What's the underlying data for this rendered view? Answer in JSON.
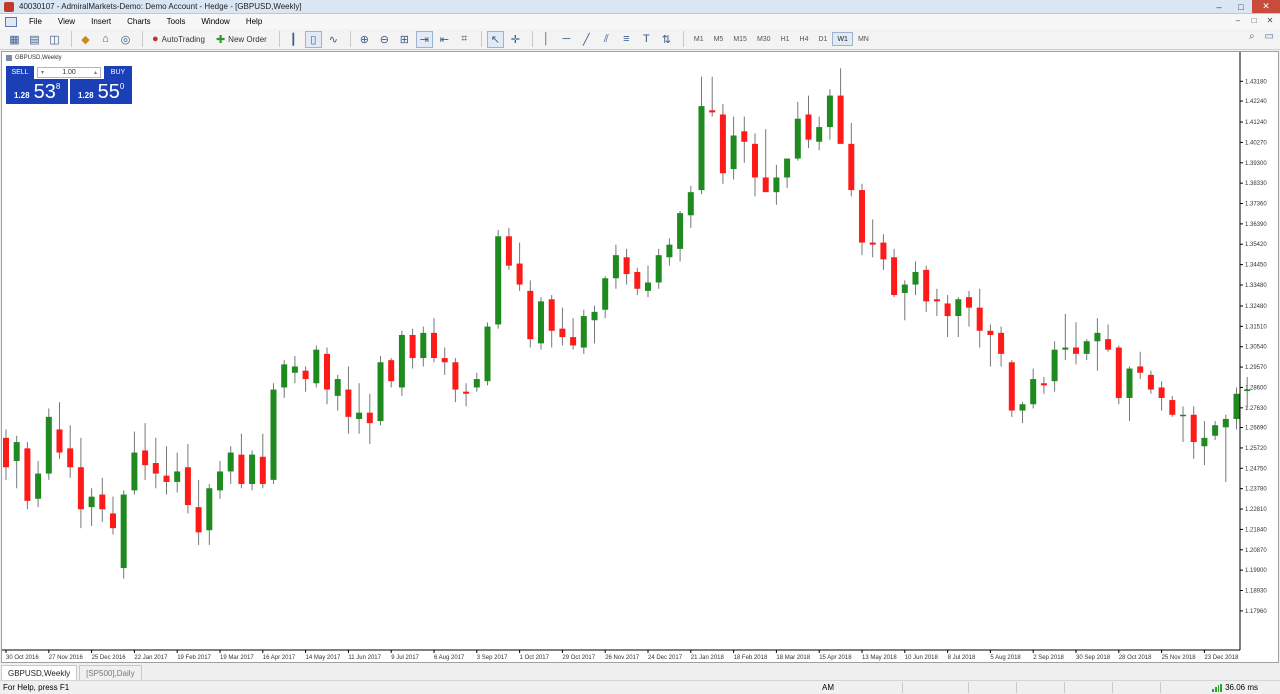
{
  "window": {
    "title": "40030107 - AdmiralMarkets-Demo: Demo Account - Hedge - [GBPUSD,Weekly]",
    "controls": [
      "–",
      "□",
      "✕"
    ]
  },
  "menu": {
    "items": [
      "File",
      "View",
      "Insert",
      "Charts",
      "Tools",
      "Window",
      "Help"
    ]
  },
  "toolbar": {
    "autotrading_label": "AutoTrading",
    "new_order_label": "New Order",
    "timeframes": [
      "M1",
      "M5",
      "M15",
      "M30",
      "H1",
      "H4",
      "D1",
      "W1",
      "MN"
    ],
    "active_timeframe": "W1"
  },
  "chart": {
    "header": "GBPUSD,Weekly",
    "trade_panel": {
      "sell_label": "SELL",
      "buy_label": "BUY",
      "lot": "1.00",
      "sell_price_prefix": "1.28",
      "sell_price_big": "53",
      "sell_price_sup": "8",
      "buy_price_prefix": "1.28",
      "buy_price_big": "55",
      "buy_price_sup": "0"
    },
    "colors": {
      "bull": "#1f8a1f",
      "bear": "#ff1a1a",
      "wick": "#777777",
      "background": "#ffffff"
    }
  },
  "chart_data": {
    "type": "candlestick",
    "symbol": "GBPUSD",
    "timeframe": "Weekly",
    "ylim": [
      1.1624,
      1.4448
    ],
    "y_ticks": [
      "1.43180",
      "1.42240",
      "1.41240",
      "1.40270",
      "1.39300",
      "1.38330",
      "1.37360",
      "1.36390",
      "1.35420",
      "1.34450",
      "1.33480",
      "1.32480",
      "1.31510",
      "1.30540",
      "1.29570",
      "1.28600",
      "1.27630",
      "1.26690",
      "1.25720",
      "1.24750",
      "1.23780",
      "1.22810",
      "1.21840",
      "1.20870",
      "1.19900",
      "1.18930",
      "1.17960"
    ],
    "x_ticks": [
      "30 Oct 2016",
      "27 Nov 2016",
      "25 Dec 2016",
      "22 Jan 2017",
      "19 Feb 2017",
      "19 Mar 2017",
      "16 Apr 2017",
      "14 May 2017",
      "11 Jun 2017",
      "9 Jul 2017",
      "6 Aug 2017",
      "3 Sep 2017",
      "1 Oct 2017",
      "29 Oct 2017",
      "26 Nov 2017",
      "24 Dec 2017",
      "21 Jan 2018",
      "18 Feb 2018",
      "18 Mar 2018",
      "15 Apr 2018",
      "13 May 2018",
      "10 Jun 2018",
      "8 Jul 2018",
      "5 Aug 2018",
      "2 Sep 2018",
      "30 Sep 2018",
      "28 Oct 2018",
      "25 Nov 2018",
      "23 Dec 2018"
    ],
    "x_tick_index_step": 4,
    "candles": [
      [
        1.262,
        1.266,
        1.242,
        1.248
      ],
      [
        1.251,
        1.263,
        1.238,
        1.26
      ],
      [
        1.257,
        1.26,
        1.228,
        1.232
      ],
      [
        1.233,
        1.251,
        1.229,
        1.245
      ],
      [
        1.245,
        1.276,
        1.242,
        1.272
      ],
      [
        1.266,
        1.279,
        1.252,
        1.255
      ],
      [
        1.257,
        1.268,
        1.243,
        1.248
      ],
      [
        1.248,
        1.262,
        1.219,
        1.228
      ],
      [
        1.229,
        1.238,
        1.22,
        1.234
      ],
      [
        1.235,
        1.243,
        1.222,
        1.228
      ],
      [
        1.226,
        1.234,
        1.216,
        1.219
      ],
      [
        1.2,
        1.237,
        1.195,
        1.235
      ],
      [
        1.237,
        1.265,
        1.235,
        1.255
      ],
      [
        1.256,
        1.269,
        1.242,
        1.249
      ],
      [
        1.25,
        1.262,
        1.238,
        1.245
      ],
      [
        1.244,
        1.258,
        1.235,
        1.241
      ],
      [
        1.241,
        1.255,
        1.236,
        1.246
      ],
      [
        1.248,
        1.259,
        1.226,
        1.23
      ],
      [
        1.229,
        1.242,
        1.211,
        1.217
      ],
      [
        1.218,
        1.24,
        1.211,
        1.238
      ],
      [
        1.237,
        1.251,
        1.233,
        1.246
      ],
      [
        1.246,
        1.258,
        1.24,
        1.255
      ],
      [
        1.254,
        1.264,
        1.238,
        1.24
      ],
      [
        1.24,
        1.256,
        1.237,
        1.254
      ],
      [
        1.253,
        1.264,
        1.238,
        1.24
      ],
      [
        1.242,
        1.288,
        1.24,
        1.285
      ],
      [
        1.286,
        1.299,
        1.281,
        1.297
      ],
      [
        1.293,
        1.301,
        1.288,
        1.296
      ],
      [
        1.294,
        1.296,
        1.284,
        1.29
      ],
      [
        1.288,
        1.306,
        1.286,
        1.304
      ],
      [
        1.302,
        1.305,
        1.278,
        1.285
      ],
      [
        1.282,
        1.292,
        1.275,
        1.29
      ],
      [
        1.285,
        1.296,
        1.264,
        1.272
      ],
      [
        1.271,
        1.288,
        1.264,
        1.274
      ],
      [
        1.274,
        1.283,
        1.259,
        1.269
      ],
      [
        1.27,
        1.301,
        1.268,
        1.298
      ],
      [
        1.299,
        1.3,
        1.286,
        1.289
      ],
      [
        1.286,
        1.313,
        1.282,
        1.311
      ],
      [
        1.311,
        1.314,
        1.295,
        1.3
      ],
      [
        1.3,
        1.315,
        1.296,
        1.312
      ],
      [
        1.312,
        1.319,
        1.298,
        1.3
      ],
      [
        1.3,
        1.305,
        1.292,
        1.298
      ],
      [
        1.298,
        1.3,
        1.279,
        1.285
      ],
      [
        1.284,
        1.288,
        1.277,
        1.283
      ],
      [
        1.286,
        1.293,
        1.284,
        1.29
      ],
      [
        1.289,
        1.317,
        1.287,
        1.315
      ],
      [
        1.316,
        1.361,
        1.314,
        1.358
      ],
      [
        1.358,
        1.362,
        1.342,
        1.344
      ],
      [
        1.345,
        1.355,
        1.332,
        1.335
      ],
      [
        1.332,
        1.337,
        1.305,
        1.309
      ],
      [
        1.307,
        1.329,
        1.304,
        1.327
      ],
      [
        1.328,
        1.33,
        1.305,
        1.313
      ],
      [
        1.314,
        1.324,
        1.306,
        1.31
      ],
      [
        1.31,
        1.319,
        1.304,
        1.306
      ],
      [
        1.305,
        1.323,
        1.302,
        1.32
      ],
      [
        1.318,
        1.325,
        1.307,
        1.322
      ],
      [
        1.323,
        1.339,
        1.319,
        1.338
      ],
      [
        1.338,
        1.354,
        1.333,
        1.349
      ],
      [
        1.348,
        1.352,
        1.335,
        1.34
      ],
      [
        1.341,
        1.343,
        1.33,
        1.333
      ],
      [
        1.332,
        1.344,
        1.329,
        1.336
      ],
      [
        1.336,
        1.352,
        1.333,
        1.349
      ],
      [
        1.348,
        1.357,
        1.344,
        1.354
      ],
      [
        1.352,
        1.37,
        1.346,
        1.369
      ],
      [
        1.368,
        1.382,
        1.362,
        1.379
      ],
      [
        1.38,
        1.434,
        1.378,
        1.42
      ],
      [
        1.418,
        1.434,
        1.415,
        1.417
      ],
      [
        1.416,
        1.421,
        1.383,
        1.388
      ],
      [
        1.39,
        1.415,
        1.385,
        1.406
      ],
      [
        1.408,
        1.415,
        1.393,
        1.403
      ],
      [
        1.402,
        1.407,
        1.377,
        1.386
      ],
      [
        1.386,
        1.409,
        1.382,
        1.379
      ],
      [
        1.379,
        1.392,
        1.373,
        1.386
      ],
      [
        1.386,
        1.395,
        1.381,
        1.395
      ],
      [
        1.395,
        1.422,
        1.394,
        1.414
      ],
      [
        1.416,
        1.425,
        1.4,
        1.404
      ],
      [
        1.403,
        1.415,
        1.399,
        1.41
      ],
      [
        1.41,
        1.428,
        1.404,
        1.425
      ],
      [
        1.425,
        1.438,
        1.408,
        1.402
      ],
      [
        1.402,
        1.412,
        1.377,
        1.38
      ],
      [
        1.38,
        1.383,
        1.349,
        1.355
      ],
      [
        1.355,
        1.366,
        1.348,
        1.354
      ],
      [
        1.355,
        1.359,
        1.342,
        1.347
      ],
      [
        1.348,
        1.352,
        1.329,
        1.33
      ],
      [
        1.331,
        1.337,
        1.318,
        1.335
      ],
      [
        1.335,
        1.346,
        1.33,
        1.341
      ],
      [
        1.342,
        1.344,
        1.322,
        1.327
      ],
      [
        1.328,
        1.333,
        1.32,
        1.327
      ],
      [
        1.326,
        1.33,
        1.31,
        1.32
      ],
      [
        1.32,
        1.329,
        1.31,
        1.328
      ],
      [
        1.329,
        1.332,
        1.315,
        1.324
      ],
      [
        1.324,
        1.333,
        1.305,
        1.313
      ],
      [
        1.313,
        1.316,
        1.296,
        1.311
      ],
      [
        1.312,
        1.315,
        1.296,
        1.302
      ],
      [
        1.298,
        1.299,
        1.272,
        1.275
      ],
      [
        1.275,
        1.279,
        1.269,
        1.278
      ],
      [
        1.278,
        1.295,
        1.276,
        1.29
      ],
      [
        1.288,
        1.291,
        1.283,
        1.287
      ],
      [
        1.289,
        1.308,
        1.284,
        1.304
      ],
      [
        1.304,
        1.321,
        1.299,
        1.305
      ],
      [
        1.305,
        1.317,
        1.297,
        1.302
      ],
      [
        1.302,
        1.309,
        1.299,
        1.308
      ],
      [
        1.308,
        1.319,
        1.294,
        1.312
      ],
      [
        1.309,
        1.316,
        1.303,
        1.304
      ],
      [
        1.305,
        1.306,
        1.278,
        1.281
      ],
      [
        1.281,
        1.296,
        1.27,
        1.295
      ],
      [
        1.296,
        1.303,
        1.29,
        1.293
      ],
      [
        1.292,
        1.294,
        1.283,
        1.285
      ],
      [
        1.286,
        1.289,
        1.275,
        1.281
      ],
      [
        1.28,
        1.282,
        1.272,
        1.273
      ],
      [
        1.273,
        1.277,
        1.26,
        1.273
      ],
      [
        1.273,
        1.277,
        1.252,
        1.26
      ],
      [
        1.258,
        1.27,
        1.249,
        1.262
      ],
      [
        1.263,
        1.27,
        1.261,
        1.268
      ],
      [
        1.267,
        1.273,
        1.241,
        1.271
      ],
      [
        1.271,
        1.286,
        1.266,
        1.283
      ],
      [
        1.285,
        1.291,
        1.276,
        1.285
      ]
    ]
  },
  "tabs": [
    "GBPUSD,Weekly",
    "[SP500],Daily"
  ],
  "status": {
    "help": "For Help, press F1",
    "profile": "AM",
    "ping": "36.06 ms"
  }
}
